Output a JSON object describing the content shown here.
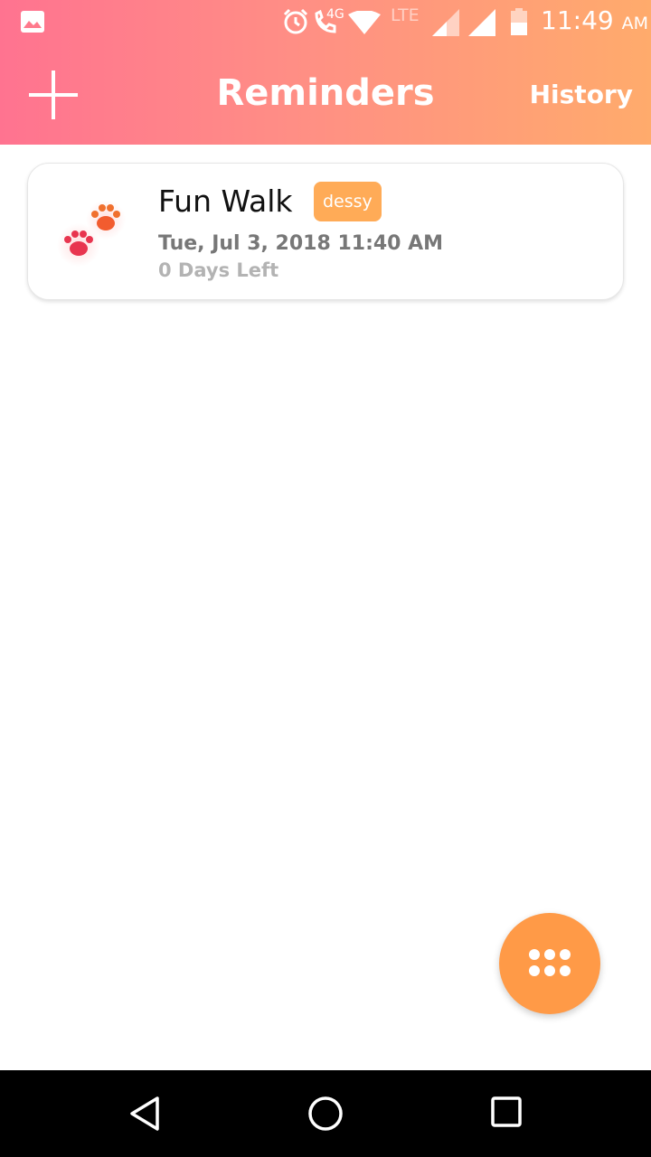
{
  "status_bar": {
    "network_label": "4G",
    "lte_label": "LTE",
    "time": "11:49",
    "ampm": "AM",
    "icons": [
      "gallery-icon",
      "alarm-icon",
      "call-icon",
      "wifi-icon",
      "signal-icon",
      "signal-icon",
      "battery-icon"
    ]
  },
  "header": {
    "title": "Reminders",
    "history_label": "History",
    "add_icon": "plus-icon",
    "gradient": [
      "#ff7390",
      "#ffab6c"
    ]
  },
  "reminders": [
    {
      "name": "Fun Walk",
      "tag": "dessy",
      "datetime": "Tue, Jul 3, 2018 11:40 AM",
      "days_left": "0 Days Left",
      "icon": "paw-prints-icon"
    }
  ],
  "fab": {
    "icon": "grid-dots-icon",
    "color": "#ff9a47"
  },
  "nav_bar": {
    "icons": [
      "back-icon",
      "home-icon",
      "recents-icon"
    ]
  }
}
